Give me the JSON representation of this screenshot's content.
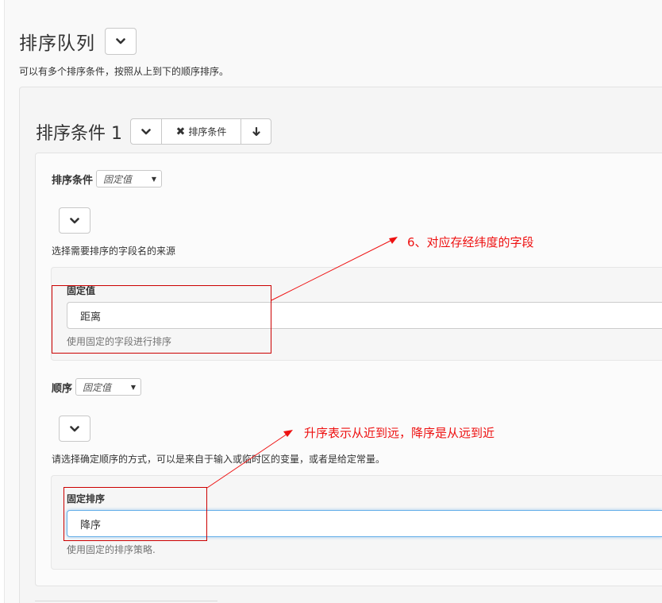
{
  "queue": {
    "title": "排序队列",
    "description": "可以有多个排序条件，按照从上到下的顺序排序。"
  },
  "condition": {
    "title": "排序条件 1",
    "delete_label": "排序条件",
    "delete_glyph": "✖",
    "down_glyph": "🡇"
  },
  "sort_field": {
    "label": "排序条件",
    "mode_select": "固定值",
    "help": "选择需要排序的字段名的来源",
    "fixed_label": "固定值",
    "fixed_value": "距离",
    "fixed_help": "使用固定的字段进行排序"
  },
  "order": {
    "label": "顺序",
    "mode_select": "固定值",
    "help": "请选择确定顺序的方式，可以是来自于输入或临时区的变量，或者是给定常量。",
    "fixed_label": "固定排序",
    "fixed_value": "降序",
    "fixed_help": "使用固定的排序策略."
  },
  "annotations": {
    "field_note": "6、对应存经纬度的字段",
    "order_note": "升序表示从近到远，降序是从远到近"
  },
  "colors": {
    "annotation_red": "#ee1111",
    "focus_blue": "#66afe9"
  }
}
